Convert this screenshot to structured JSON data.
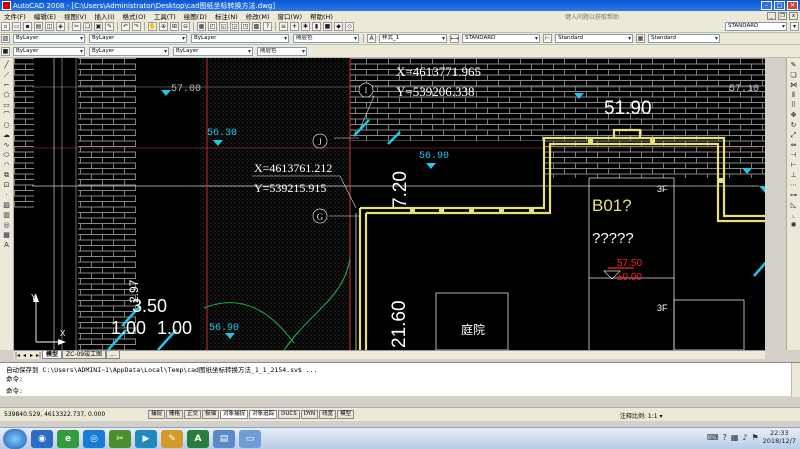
{
  "window": {
    "title": "AutoCAD 2008 - [C:\\Users\\Administrator\\Desktop\\cad图纸坐标转换方法.dwg]"
  },
  "menu": {
    "items": [
      "文件(F)",
      "编辑(E)",
      "视图(V)",
      "插入(I)",
      "格式(O)",
      "工具(T)",
      "绘图(D)",
      "标注(N)",
      "修改(M)",
      "窗口(W)",
      "帮助(H)"
    ],
    "help_placeholder": "键入问题以获取帮助"
  },
  "toolbar": {
    "standard_combo": "STANDARD",
    "layer_combo": "ByLayer",
    "linetype_combo": "ByLayer",
    "lineweight_combo": "ByLayer",
    "color_combo": "随层色",
    "plotstyle_combo": "样式_1",
    "textstyle_combo": "STANDARD",
    "dimstyle_combo": "Standard",
    "tablestyle_combo": "Standard"
  },
  "drawing": {
    "coord1_x": "X=4613771.965",
    "coord1_y": "Y=539206.338",
    "coord2_x": "X=4613761.212",
    "coord2_y": "Y=539215.915",
    "grid_I": "I",
    "grid_J": "J",
    "grid_G": "G",
    "elev_5700a": "57.00",
    "elev_5700b": "57.10",
    "elev_5630": "56.30",
    "elev_5690a": "56.90",
    "elev_5690b": "56.90",
    "elev_5190": "51.90",
    "elev_5750": "57.50",
    "elev_zero": "±0.00",
    "dim_720": "7.20",
    "dim_350": "3.50",
    "dim_100a": "1.00",
    "dim_100b": "1.00",
    "dim_2160": "21.60",
    "dim_297": "2.97",
    "floor_3f_a": "3F",
    "floor_3f_b": "3F",
    "room_b01": "B01?",
    "room_q": "?????",
    "courtyard": "庭院",
    "ucs_y": "Y",
    "ucs_x": "X"
  },
  "layout_tabs": [
    "模型",
    "ZC-09竣工图",
    "..."
  ],
  "command": {
    "line1": "自动保存到 C:\\Users\\ADMINI~1\\AppData\\Local\\Temp\\cad图纸坐标转换方法_1_1_2154.sv$ ...",
    "line2": "命令:",
    "line3": "命令:"
  },
  "status": {
    "coords": "539840.529, 4613322.737, 0.000",
    "buttons": [
      "捕捉",
      "栅格",
      "正交",
      "极轴",
      "对象捕捉",
      "对象追踪",
      "DUCS",
      "DYN",
      "线宽",
      "模型"
    ],
    "annotation_scale": "注释比例: 1:1 ▾"
  },
  "taskbar": {
    "time": "22:33",
    "date": "2018/12/7",
    "apps": [
      "资源管理器",
      "IE浏览器",
      "360浏览器",
      "截图",
      "播放器",
      "画图",
      "AutoCAD",
      "记事本",
      "文件夹"
    ]
  },
  "colors": {
    "canvas": "#000000",
    "wall": "#e8e07a",
    "text_white": "#ffffff",
    "cyan": "#1ec8e8",
    "red": "#ff2020"
  }
}
